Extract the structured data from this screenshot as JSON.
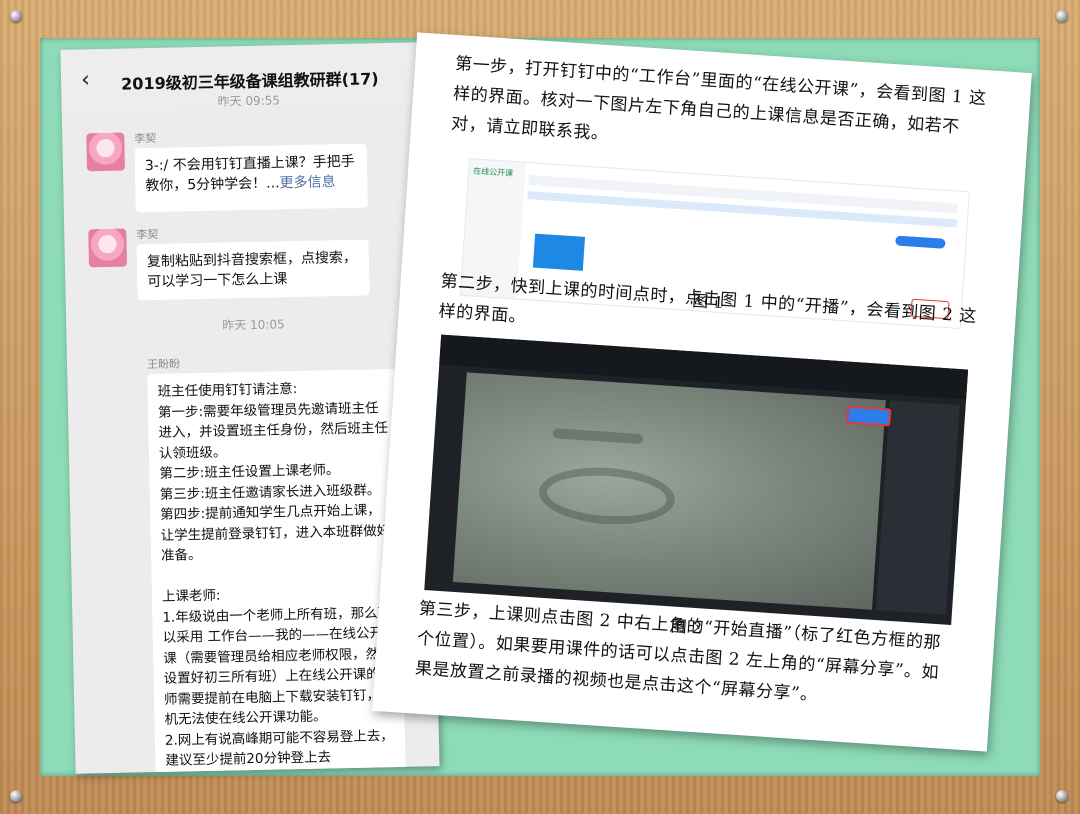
{
  "phone": {
    "title": "2019级初三年级备课组教研群(17)",
    "time_top": "昨天 09:55",
    "messages": [
      {
        "sender": "李契",
        "text": "3-:/ 不会用钉钉直播上课？手把手教你，5分钟学会！...",
        "more": "更多信息"
      },
      {
        "sender": "李契",
        "text": "复制粘贴到抖音搜索框，点搜索，可以学习一下怎么上课"
      }
    ],
    "time_mid": "昨天 10:05",
    "long_sender": "王盼盼",
    "long_text": "班主任使用钉钉请注意:\n第一步:需要年级管理员先邀请班主任进入，并设置班主任身份，然后班主任认领班级。\n第二步:班主任设置上课老师。\n第三步:班主任邀请家长进入班级群。\n第四步:提前通知学生几点开始上课，让学生提前登录钉钉，进入本班群做好准备。\n\n上课老师:\n1.年级说由一个老师上所有班，那么可以采用 工作台——我的——在线公开课（需要管理员给相应老师权限，然后设置好初三所有班）上在线公开课的老师需要提前在电脑上下载安装钉钉，手机无法使在线公开课功能。\n2.网上有说高峰期可能不容易登上去，建议至少提前20分钟登上去"
  },
  "doc": {
    "para1": "第一步，打开钉钉中的“工作台”里面的“在线公开课”，会看到图 1 这样的界面。核对一下图片左下角自己的上课信息是否正确，如若不对，请立即联系我。",
    "fig1_caption": "图 1",
    "fig1_logo": "在线公开课",
    "para2": "第二步，快到上课的时间点时，点击图 1 中的“开播”，会看到图 2 这样的界面。",
    "fig2_caption": "图 2",
    "para3": "第三步，上课则点击图 2 中右上角的“开始直播”（标了红色方框的那个位置）。如果要用课件的话可以点击图 2 左上角的“屏幕分享”。如果是放置之前录播的视频也是点击这个“屏幕分享”。"
  }
}
